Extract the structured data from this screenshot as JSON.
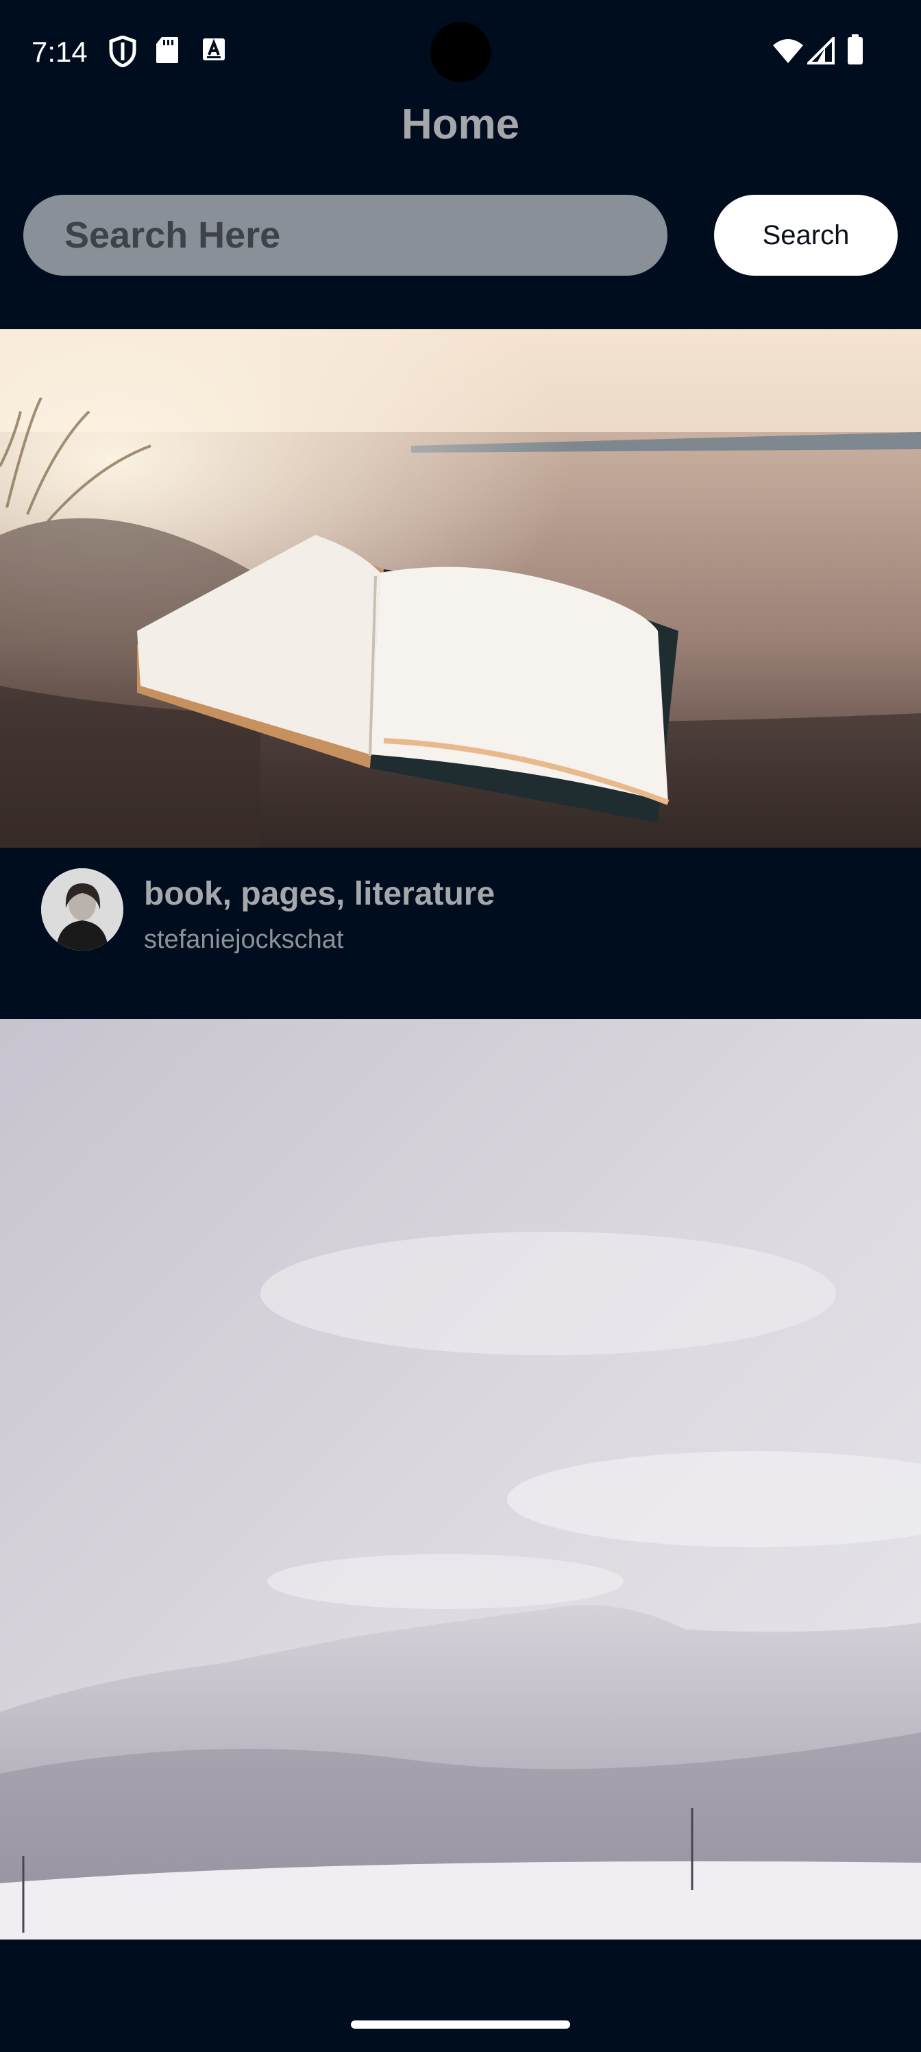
{
  "status_bar": {
    "time": "7:14",
    "left_icons": [
      "shield-icon",
      "sd-card-icon",
      "keyboard-a-icon"
    ],
    "right_icons": [
      "wifi-icon",
      "signal-icon",
      "battery-icon"
    ]
  },
  "header": {
    "title": "Home"
  },
  "search": {
    "placeholder": "Search Here",
    "value": "",
    "button_label": "Search"
  },
  "feed": {
    "items": [
      {
        "image": "open book on sandy beach",
        "tags": "book, pages, literature",
        "author": "stefaniejockschat",
        "avatar": "user-avatar"
      },
      {
        "image": "snow-covered mountains under overcast sky"
      }
    ]
  },
  "colors": {
    "background": "#000d1e",
    "title_text": "#a5a7ab",
    "search_field": "#8a9097",
    "search_button": "#ffffff"
  }
}
